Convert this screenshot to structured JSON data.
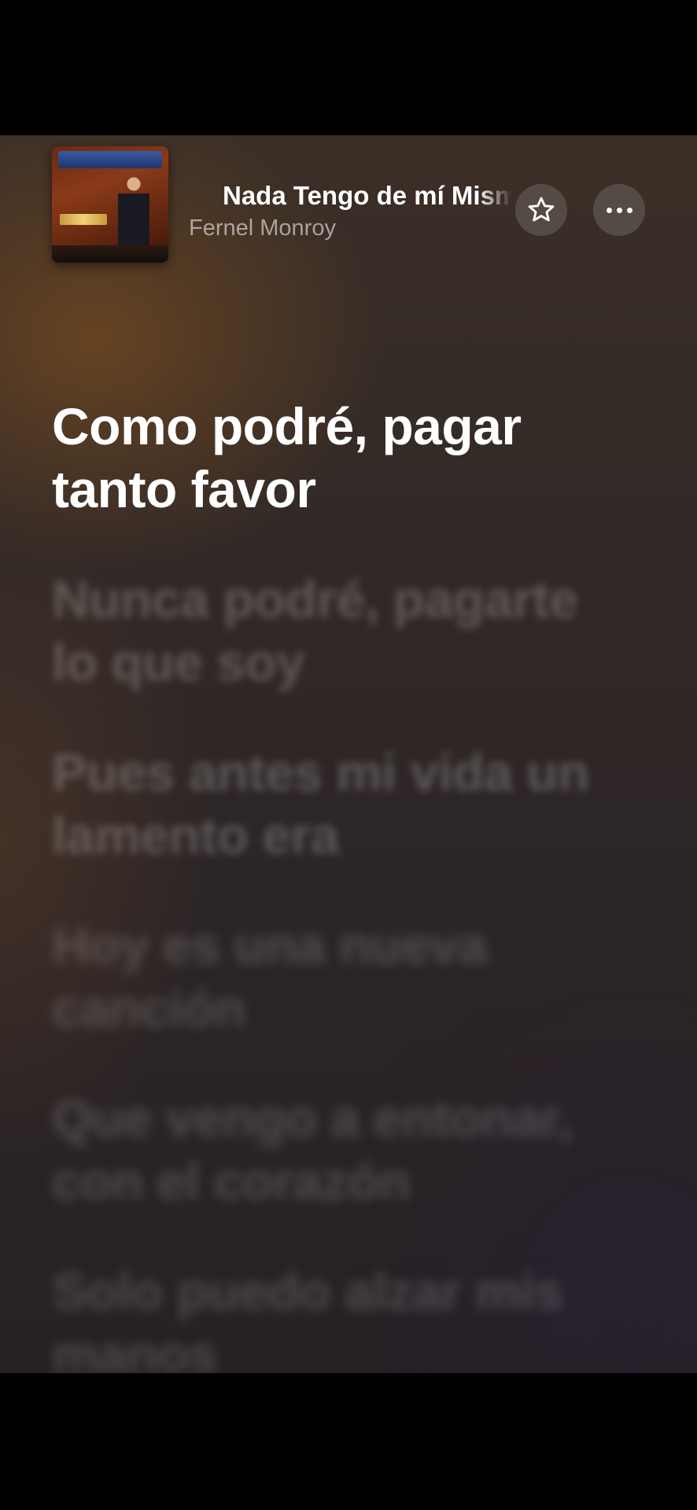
{
  "player": {
    "song_title": "Nada Tengo de mí Mismo",
    "artist": "Fernel Monroy",
    "album_art_icon": "album-cover"
  },
  "controls": {
    "favorite_icon": "star-icon",
    "more_icon": "ellipsis-icon"
  },
  "lyrics": {
    "lines": [
      "Como podré, pagar tanto favor",
      "Nunca podré, pagarte lo que soy",
      "Pues antes mi vida un lamento era",
      "Hoy es una nueva canción",
      "Que vengo a entonar, con el corazón",
      "Solo puedo alzar mis manos"
    ],
    "active_index": 0
  },
  "colors": {
    "active_lyric": "#ffffff",
    "inactive_lyric": "rgba(255,255,255,0.22)",
    "background_warm": "#3b2f27",
    "background_dark": "#262123"
  }
}
